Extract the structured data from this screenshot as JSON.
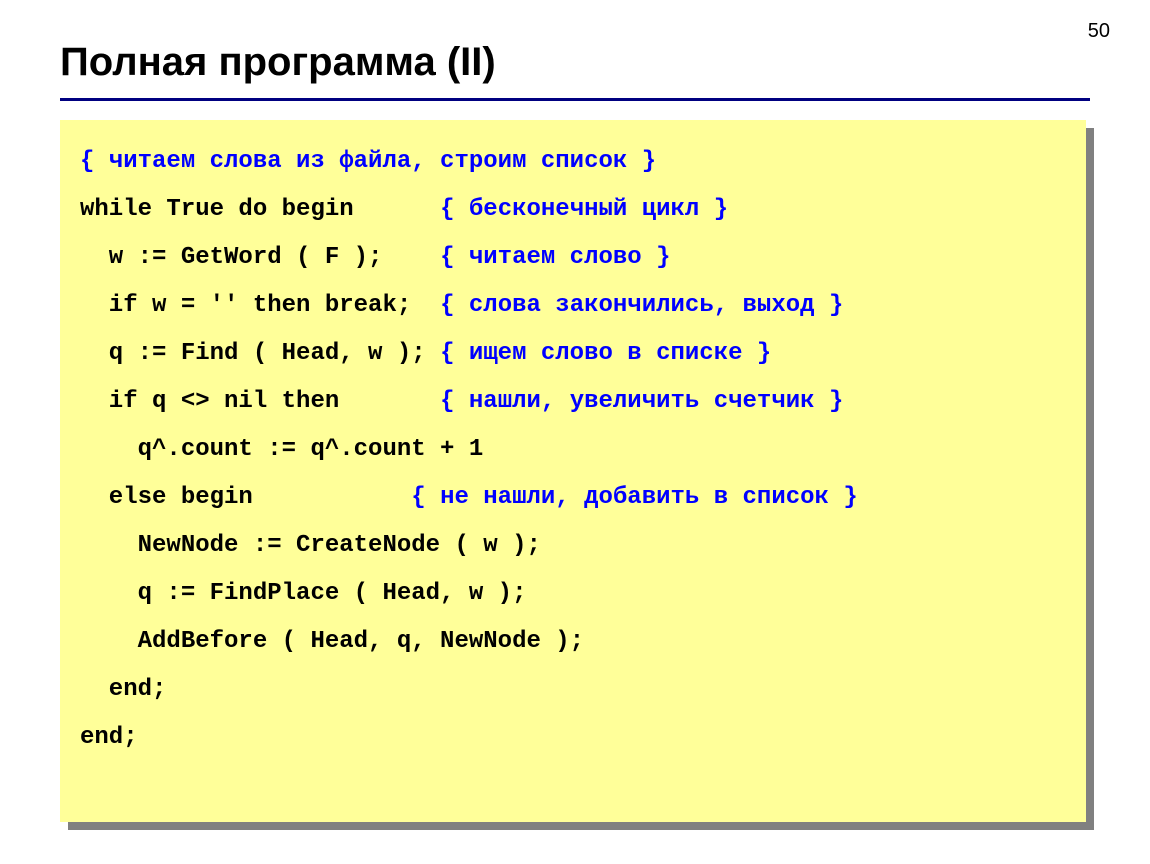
{
  "page_number": "50",
  "title": "Полная программа (II)",
  "code": {
    "l1_comment": "{ читаем слова из файла, строим список }",
    "l2_code": "while True do begin",
    "l2_comment": "{ бесконечный цикл }",
    "l3_code": "  w := GetWord ( F );",
    "l3_comment": "{ читаем слово }",
    "l4_code": "  if w = '' then break;",
    "l4_comment": "{ слова закончились, выход }",
    "l5_code": "  q := Find ( Head, w );",
    "l5_comment": "{ ищем слово в списке }",
    "l6_code": "  if q <> nil then",
    "l6_comment": "{ нашли, увеличить счетчик }",
    "l7_code": "    q^.count := q^.count + 1",
    "l8_code": "  else begin",
    "l8_comment": "{ не нашли, добавить в список }",
    "l9_code": "    NewNode := CreateNode ( w );",
    "l10_code": "    q := FindPlace ( Head, w );",
    "l11_code": "    AddBefore ( Head, q, NewNode );",
    "l12_code": "  end;",
    "l13_code": "end;"
  }
}
